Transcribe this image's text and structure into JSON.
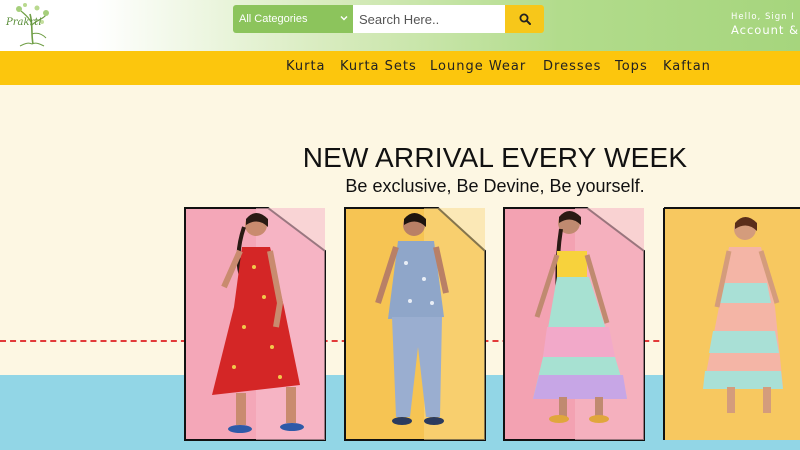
{
  "header": {
    "logo_text": "Prakrti",
    "category_select": "All Categories",
    "search_placeholder": "Search Here..",
    "account_line1": "Hello, Sign I",
    "account_line2": "Account &"
  },
  "nav": {
    "items": [
      "Kurta",
      "Kurta Sets",
      "Lounge Wear",
      "Dresses",
      "Tops",
      "Kaftan"
    ]
  },
  "hero": {
    "headline": "NEW ARRIVAL EVERY WEEK",
    "subline": "Be exclusive, Be Devine, Be yourself."
  },
  "cards": [
    {
      "bg": "#f4a7b8",
      "outfit": "#d42626",
      "accent": "#f2c94c"
    },
    {
      "bg": "#f6c453",
      "outfit": "#8fa6c9",
      "accent": "#e9eef6"
    },
    {
      "bg": "#f3a2b2",
      "outfit": "#a7e1d2",
      "accent": "#f7d23c"
    },
    {
      "bg": "#f7c860",
      "outfit": "#f4b5a6",
      "accent": "#a9e0d6"
    }
  ],
  "colors": {
    "nav_bg": "#fcc60d",
    "search_button": "#f7c71a",
    "category_bg": "#8cc45c",
    "hero_bg": "#fdf7e3",
    "hero_bottom": "#92d6e6",
    "dash_line": "#e23a3a"
  }
}
